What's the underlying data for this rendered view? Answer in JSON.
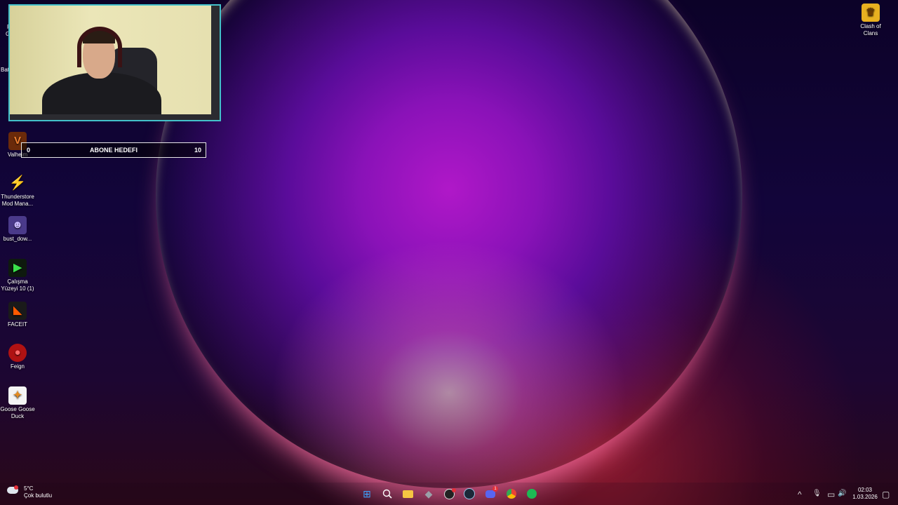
{
  "desktop_icons": [
    {
      "label": "Valheim",
      "icon": "valheim-icon",
      "glyph": "V",
      "color": "#b04a10"
    },
    {
      "label": "Thunderstore Mod Mana...",
      "icon": "thunderstore-icon",
      "glyph": "⚡",
      "color": "#1d6fb8"
    },
    {
      "label": "bust_dow...",
      "icon": "bust-down-icon",
      "glyph": "☻",
      "color": "#5b4a9a"
    },
    {
      "label": "Çalışma Yüzeyi 10 (1)",
      "icon": "workspace-icon",
      "glyph": "▶",
      "color": "#1a7a2a"
    },
    {
      "label": "FACEIT",
      "icon": "faceit-icon",
      "glyph": "◣",
      "color": "#f25a00"
    },
    {
      "label": "Feign",
      "icon": "feign-icon",
      "glyph": "●",
      "color": "#c01616"
    },
    {
      "label": "Goose Goose Duck",
      "icon": "goose-goose-duck-icon",
      "glyph": "🦆",
      "color": "#f0f0f0"
    },
    {
      "label": "Clash of Clans",
      "icon": "clash-of-clans-icon",
      "glyph": "♛",
      "color": "#e8b020"
    }
  ],
  "partial_labels": {
    "left_a": "R",
    "left_b": "G",
    "bat": "Bat"
  },
  "subscriber_goal": {
    "start": "0",
    "title": "ABONE HEDEFI",
    "target": "10",
    "progress": 0
  },
  "weather": {
    "temp": "5°C",
    "desc": "Çok bulutlu"
  },
  "taskbar": {
    "apps": [
      {
        "name": "start-button",
        "glyph": "⊞",
        "color": "#3ba3ff"
      },
      {
        "name": "search-button",
        "glyph": "⌕",
        "color": "#ffffff"
      },
      {
        "name": "file-explorer-button",
        "glyph": "▬",
        "color": "#f5c542"
      },
      {
        "name": "app-cube-button",
        "glyph": "◆",
        "color": "#9aa0a8"
      },
      {
        "name": "obs-button",
        "glyph": "◉",
        "color": "#e0e0e0"
      },
      {
        "name": "steam-button",
        "glyph": "◍",
        "color": "#9bc4e6"
      },
      {
        "name": "discord-button",
        "glyph": "☺",
        "color": "#5865f2"
      },
      {
        "name": "chrome-button",
        "glyph": "◎",
        "color": "#34a853"
      },
      {
        "name": "spotify-button",
        "glyph": "≋",
        "color": "#1db954"
      }
    ],
    "discord_badge": "1"
  },
  "tray": {
    "chevron": "^",
    "mic": "🎙",
    "network": "▭",
    "volume": "🔊",
    "notification": "▢"
  },
  "clock": {
    "time": "02:03",
    "date": "1.03.2026"
  }
}
